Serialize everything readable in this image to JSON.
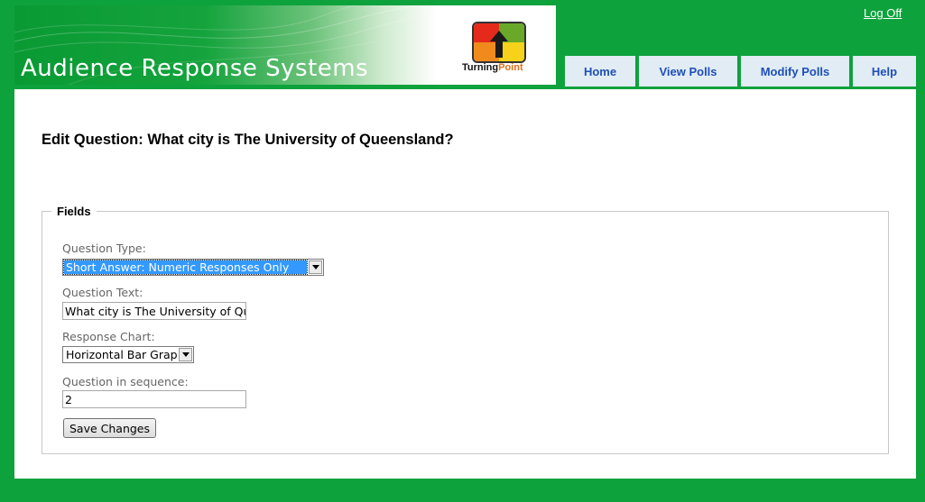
{
  "header": {
    "banner_title": "Audience Response Systems",
    "logo": {
      "name_part1": "Turning",
      "name_part2": "Point",
      "icon": "turningpoint-logo-icon"
    },
    "logoff_label": "Log Off"
  },
  "nav": {
    "tabs": [
      {
        "label": "Home"
      },
      {
        "label": "View Polls"
      },
      {
        "label": "Modify Polls"
      },
      {
        "label": "Help"
      }
    ]
  },
  "main": {
    "title": "Edit Question: What city is The University of Queensland?",
    "fieldset": {
      "legend": "Fields",
      "question_type": {
        "label": "Question Type:",
        "value": "Short Answer: Numeric Responses Only"
      },
      "question_text": {
        "label": "Question Text:",
        "value": "What city is The University of Queensland?"
      },
      "response_chart": {
        "label": "Response Chart:",
        "value": "Horizontal Bar Graph"
      },
      "sequence": {
        "label": "Question in sequence:",
        "value": "2"
      },
      "save_label": "Save Changes"
    }
  },
  "colors": {
    "background": "#0ea23d",
    "tab_background": "#e1ecf4",
    "tab_text": "#1e4fb5",
    "selection_highlight": "#3399ff"
  }
}
